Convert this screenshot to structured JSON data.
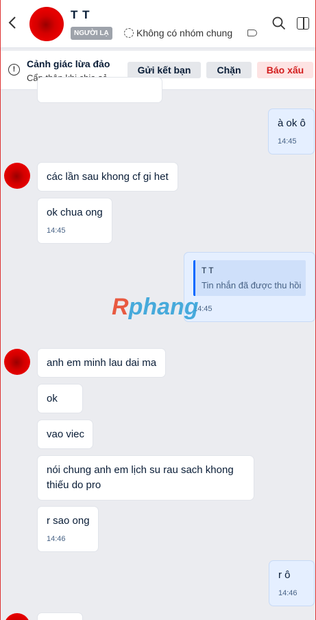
{
  "header": {
    "contact_name": "T T",
    "stranger_badge": "NGƯỜI LẠ",
    "group_info": "Không có nhóm chung"
  },
  "warning": {
    "title": "Cảnh giác lừa đảo",
    "subtitle": "Cẩn thận khi chia sẻ...",
    "add_friend_label": "Gửi kết bạn",
    "block_label": "Chặn",
    "report_label": "Báo xấu"
  },
  "messages": [
    {
      "from": "me",
      "text": "à ok ô",
      "time": "14:45"
    },
    {
      "from": "other",
      "text": "các lần sau khong cf gi het"
    },
    {
      "from": "other",
      "text": "ok chua ong",
      "time": "14:45"
    },
    {
      "from": "me",
      "quote_name": "T T",
      "quote_text": "Tin nhắn đã được thu hồi",
      "time": "14:45"
    },
    {
      "from": "other",
      "text": "anh em minh lau dai ma"
    },
    {
      "from": "other",
      "text": "ok"
    },
    {
      "from": "other",
      "text": "vao viec"
    },
    {
      "from": "other",
      "text": "nói chung anh em lịch su rau sach khong thiếu do pro"
    },
    {
      "from": "other",
      "text": "r sao ong",
      "time": "14:46"
    },
    {
      "from": "me",
      "text": "r ô",
      "time": "14:46"
    }
  ],
  "watermark": {
    "first": "R",
    "rest": "phang"
  },
  "colors": {
    "accent": "#0068ff",
    "report": "#d21d1d",
    "my_bubble": "#e5efff",
    "background": "#ebecf0"
  }
}
